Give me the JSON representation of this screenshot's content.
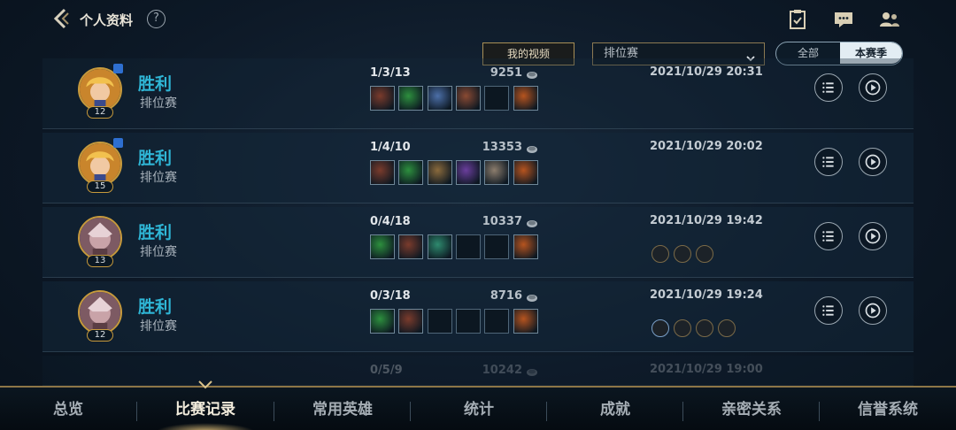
{
  "header": {
    "title": "个人资料",
    "help_label": "?",
    "icons": [
      "back-icon",
      "help-icon",
      "task-clipboard-icon",
      "chat-icon",
      "friends-icon"
    ]
  },
  "filters": {
    "video_button": "我的视频",
    "mode_select_value": "排位赛",
    "season_options": [
      "全部",
      "本赛季"
    ],
    "season_selected": "本赛季"
  },
  "matches": [
    {
      "result": "胜利",
      "mode": "排位赛",
      "level": "12",
      "kda": "1/3/13",
      "gold": "9251",
      "time": "2021/10/29 20:31",
      "champion_icon": "golden-hair-champion",
      "runes": []
    },
    {
      "result": "胜利",
      "mode": "排位赛",
      "level": "15",
      "kda": "1/4/10",
      "gold": "13353",
      "time": "2021/10/29 20:02",
      "champion_icon": "golden-hair-champion",
      "runes": []
    },
    {
      "result": "胜利",
      "mode": "排位赛",
      "level": "13",
      "kda": "0/4/18",
      "gold": "10337",
      "time": "2021/10/29 19:42",
      "champion_icon": "pink-armored-champion",
      "runes": [
        "rune-1",
        "rune-2",
        "rune-3"
      ]
    },
    {
      "result": "胜利",
      "mode": "排位赛",
      "level": "12",
      "kda": "0/3/18",
      "gold": "8716",
      "time": "2021/10/29 19:24",
      "champion_icon": "pink-armored-champion",
      "runes": [
        "rune-1",
        "rune-2",
        "rune-3",
        "rune-4"
      ]
    },
    {
      "result": "",
      "mode": "",
      "level": "",
      "kda": "0/5/9",
      "gold": "10242",
      "time": "2021/10/29 19:00",
      "champion_icon": "",
      "runes": []
    }
  ],
  "bottom_nav": {
    "tabs": [
      "总览",
      "比赛记录",
      "常用英雄",
      "统计",
      "成就",
      "亲密关系",
      "信誉系统"
    ],
    "active": "比赛记录"
  },
  "colors": {
    "accent_gold": "#c79a3c",
    "victory_blue": "#2fb6d6",
    "background": "#0d1927"
  }
}
